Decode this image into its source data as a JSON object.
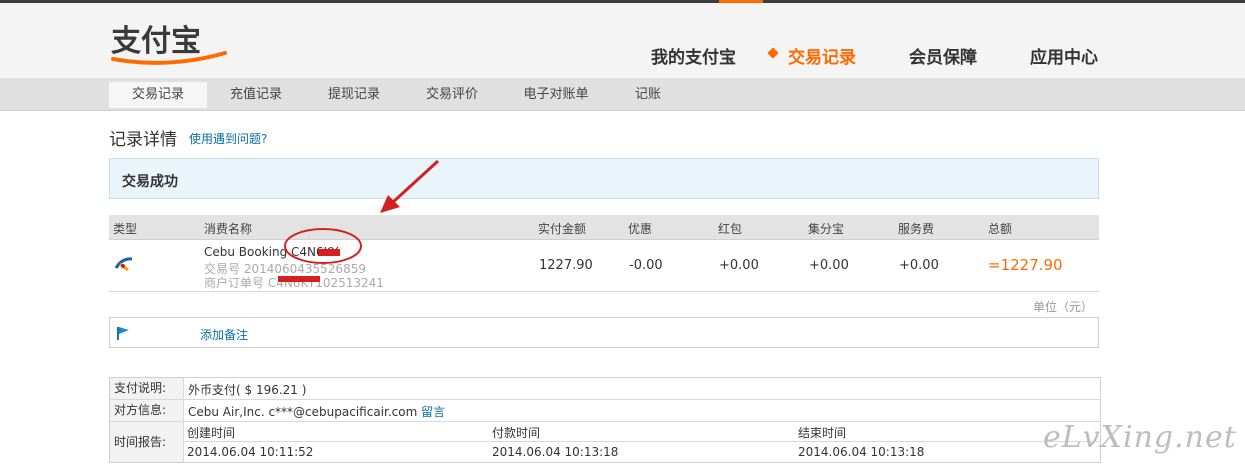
{
  "brand": {
    "logo_text": "支付宝",
    "accent": "#ff6a00",
    "link": "#0b6fa6"
  },
  "main_nav": [
    {
      "label": "我的支付宝",
      "active": false
    },
    {
      "label": "交易记录",
      "active": true
    },
    {
      "label": "会员保障",
      "active": false
    },
    {
      "label": "应用中心",
      "active": false
    }
  ],
  "sub_nav": [
    {
      "label": "交易记录",
      "active": true
    },
    {
      "label": "充值记录",
      "active": false
    },
    {
      "label": "提现记录",
      "active": false
    },
    {
      "label": "交易评价",
      "active": false
    },
    {
      "label": "电子对账单",
      "active": false
    },
    {
      "label": "记账",
      "active": false
    }
  ],
  "page": {
    "title": "记录详情",
    "help_link": "使用遇到问题?"
  },
  "status": {
    "text": "交易成功"
  },
  "table": {
    "headers": [
      "类型",
      "消费名称",
      "实付金额",
      "优惠",
      "红包",
      "集分宝",
      "服务费",
      "总额"
    ],
    "row": {
      "type_icon": "cebu-pacific-logo-icon",
      "name": "Cebu Booking  C4N6KY",
      "trade_no": "交易号 2014060435526859",
      "merchant_order": "商户订单号 C4N6KY102513241",
      "paid": "1227.90",
      "discount": "-0.00",
      "red_packet": "+0.00",
      "jifenbao": "+0.00",
      "service_fee": "+0.00",
      "total": "=1227.90"
    },
    "unit": "单位（元）"
  },
  "memo": {
    "icon": "flag-icon",
    "label": "添加备注"
  },
  "info": {
    "payment_label": "支付说明:",
    "payment_value": "外币支付( $ 196.21 )",
    "counterparty_label": "对方信息:",
    "counterparty_value": "Cebu Air,Inc. c***@cebupacificair.com",
    "counterparty_link": "留言",
    "time_label": "时间报告:",
    "times": [
      {
        "label": "创建时间",
        "value": "2014.06.04 10:11:52"
      },
      {
        "label": "付款时间",
        "value": "2014.06.04 10:13:18"
      },
      {
        "label": "结束时间",
        "value": "2014.06.04 10:13:18"
      }
    ]
  },
  "watermark": "eLvXing.net"
}
